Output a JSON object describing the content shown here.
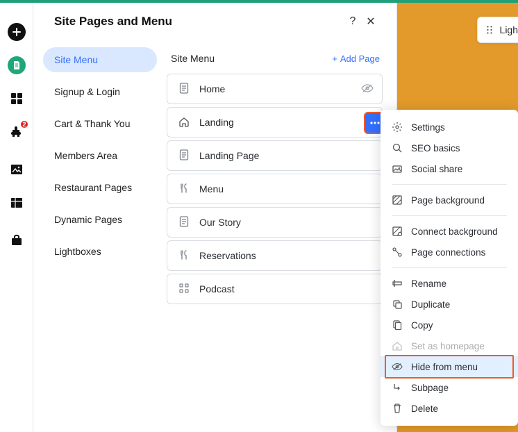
{
  "leftbar": {
    "badge_count": "2"
  },
  "panel": {
    "title": "Site Pages and Menu",
    "help_glyph": "?",
    "close_glyph": "✕"
  },
  "sidemenu": [
    {
      "label": "Site Menu",
      "active": true
    },
    {
      "label": "Signup & Login"
    },
    {
      "label": "Cart & Thank You"
    },
    {
      "label": "Members Area"
    },
    {
      "label": "Restaurant Pages"
    },
    {
      "label": "Dynamic Pages"
    },
    {
      "label": "Lightboxes"
    }
  ],
  "main": {
    "title": "Site Menu",
    "add_label": "Add Page",
    "add_glyph": "+"
  },
  "pages": [
    {
      "label": "Home",
      "hidden_icon": true
    },
    {
      "label": "Landing",
      "active": true
    },
    {
      "label": "Landing Page"
    },
    {
      "label": "Menu"
    },
    {
      "label": "Our Story"
    },
    {
      "label": "Reservations"
    },
    {
      "label": "Podcast"
    }
  ],
  "context_menu": [
    {
      "label": "Settings"
    },
    {
      "label": "SEO basics"
    },
    {
      "label": "Social share"
    },
    {
      "sep": true
    },
    {
      "label": "Page background"
    },
    {
      "sep": true
    },
    {
      "label": "Connect background"
    },
    {
      "label": "Page connections"
    },
    {
      "sep": true
    },
    {
      "label": "Rename"
    },
    {
      "label": "Duplicate"
    },
    {
      "label": "Copy"
    },
    {
      "label": "Set as homepage",
      "disabled": true
    },
    {
      "label": "Hide from menu",
      "highlight": true
    },
    {
      "label": "Subpage"
    },
    {
      "label": "Delete"
    }
  ],
  "light_button": {
    "label": "Ligh"
  }
}
